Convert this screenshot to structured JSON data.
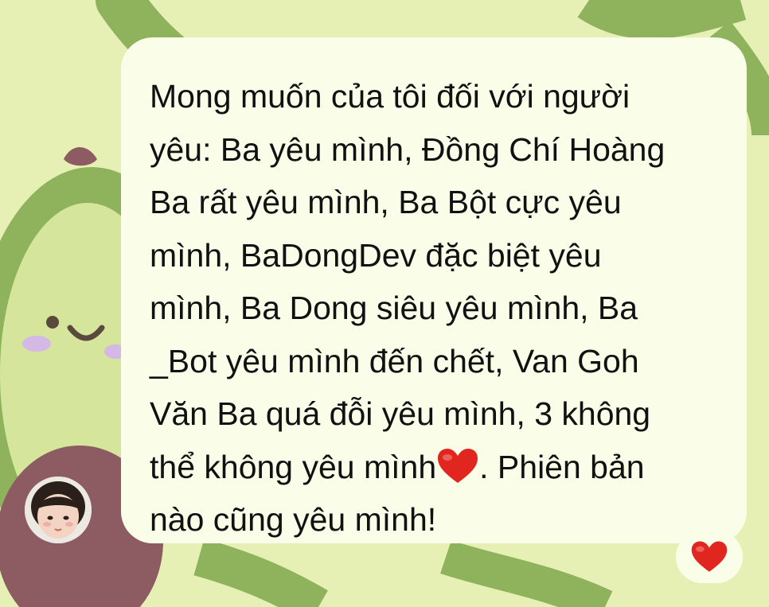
{
  "chat": {
    "message": {
      "lines": [
        "Mong muốn của tôi đối với người",
        "yêu: Ba yêu mình, Đồng Chí Hoàng",
        "Ba rất yêu mình, Ba Bột cực yêu",
        "mình, BaDongDev đặc biệt yêu",
        "mình, Ba Dong siêu yêu mình, Ba",
        "_Bot yêu mình đến chết, Van Goh",
        "Văn Ba quá đỗi yêu mình, 3 không"
      ],
      "line8_before_emoji": "thể không yêu mình",
      "line8_after_emoji": ". Phiên bản",
      "line9": "nào cũng yêu mình!",
      "inline_emoji_icon": "red-heart-emoji"
    },
    "reaction": {
      "icon": "red-heart-emoji"
    },
    "sender_avatar_icon": "child-avatar"
  },
  "colors": {
    "wallpaper": "#e6f0b4",
    "wallpaper_stripe": "#8fb35d",
    "bubble": "#fafde8",
    "text": "#111111",
    "heart": "#e0261f",
    "avatar_bg": "#8d5c63"
  }
}
